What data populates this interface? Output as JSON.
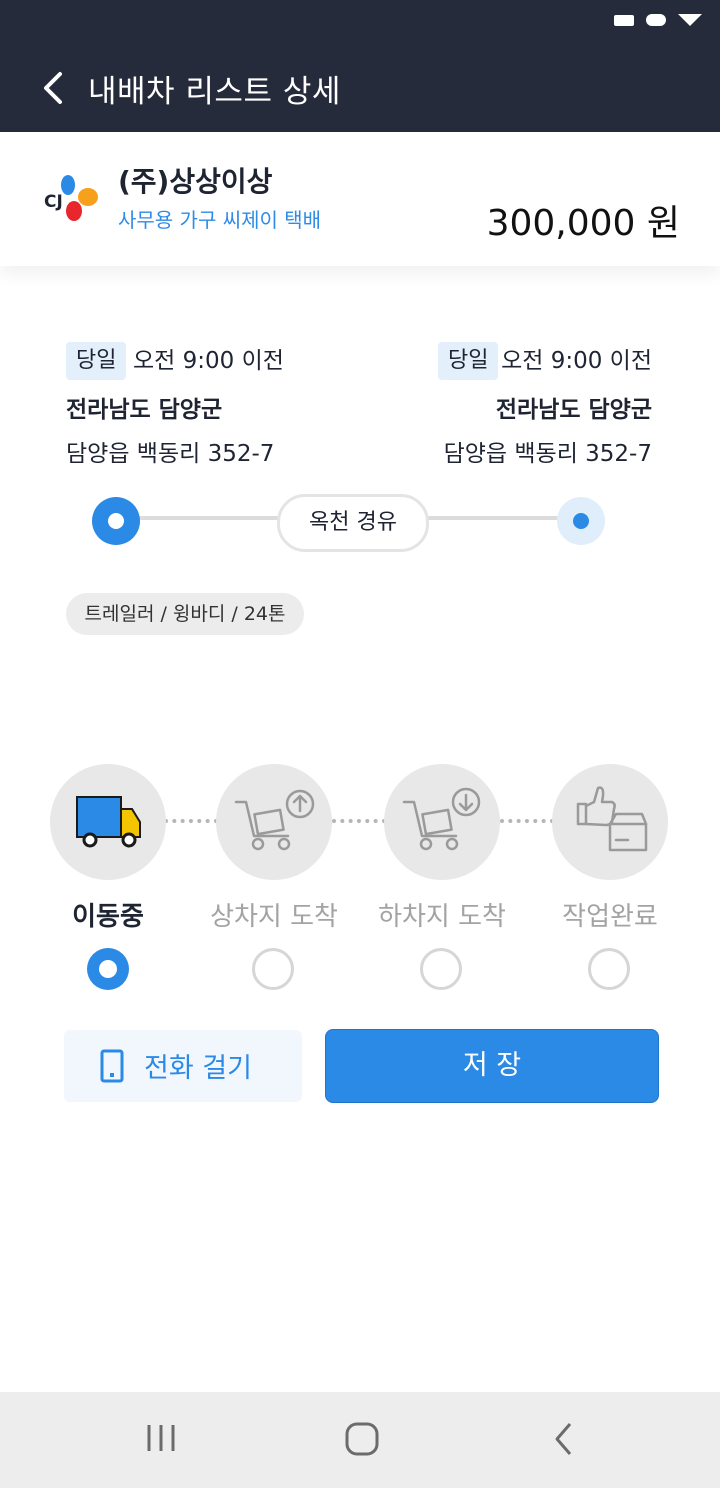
{
  "header": {
    "title": "내배차 리스트 상세",
    "background": "#262b3b"
  },
  "company": {
    "name": "(주)상상이상",
    "subtitle": "사무용 가구 씨제이 택배",
    "price": "300,000 원"
  },
  "route": {
    "origin": {
      "tag": "당일",
      "time": "오전 9:00 이전",
      "region": "전라남도 담양군",
      "address": "담양읍 백동리 352-7"
    },
    "destination": {
      "tag": "당일",
      "time": "오전 9:00 이전",
      "region": "전라남도 담양군",
      "address": "담양읍 백동리 352-7"
    },
    "via": "옥천 경유",
    "vehicle": "트레일러 / 윙바디 / 24톤"
  },
  "steps": [
    {
      "label": "이동중",
      "icon": "truck-icon",
      "selected": true
    },
    {
      "label": "상차지 도착",
      "icon": "loading-cart-icon",
      "selected": false
    },
    {
      "label": "하차지 도착",
      "icon": "unloading-cart-icon",
      "selected": false
    },
    {
      "label": "작업완료",
      "icon": "thumbs-up-box-icon",
      "selected": false
    }
  ],
  "actions": {
    "call_label": "전화 걸기",
    "save_label": "저 장"
  },
  "colors": {
    "accent": "#2a8ae6",
    "dark": "#262b3b"
  }
}
